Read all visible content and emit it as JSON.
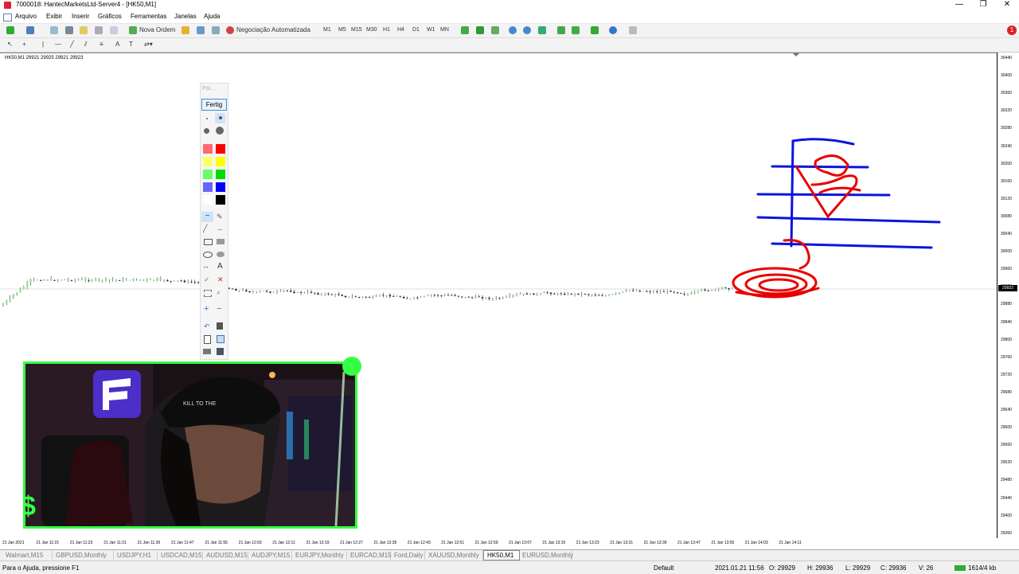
{
  "window": {
    "title": "7000018: HantecMarketsLtd-Server4 - [HK50,M1]",
    "controls": [
      "—",
      "❐",
      "✕"
    ]
  },
  "menu": [
    "Arquivo",
    "Exibir",
    "Inserir",
    "Gráficos",
    "Ferramentas",
    "Janelas",
    "Ajuda"
  ],
  "toolbar": {
    "new_order": "Nova Ordem",
    "auto_trading": "Negociação Automatizada",
    "timeframes": [
      "M1",
      "M5",
      "M15",
      "M30",
      "H1",
      "H4",
      "D1",
      "W1",
      "MN"
    ],
    "notification_count": "1"
  },
  "chart": {
    "info": "HK50,M1  29921 29925 29921 29923",
    "current_price": "29923",
    "price_ticks": [
      "30440",
      "30400",
      "30360",
      "30320",
      "30280",
      "30240",
      "30200",
      "30160",
      "30120",
      "30080",
      "30040",
      "30000",
      "29960",
      "29920",
      "29880",
      "29840",
      "29800",
      "29760",
      "29720",
      "29680",
      "29640",
      "29600",
      "29560",
      "29520",
      "29480",
      "29440",
      "29400",
      "29360"
    ],
    "time_ticks": [
      "21 Jan 2021",
      "21 Jan 11:15",
      "21 Jan 11:23",
      "21 Jan 11:31",
      "21 Jan 11:39",
      "21 Jan 11:47",
      "21 Jan 11:55",
      "21 Jan 12:03",
      "21 Jan 12:11",
      "21 Jan 12:19",
      "21 Jan 12:27",
      "21 Jan 12:35",
      "21 Jan 12:43",
      "21 Jan 12:51",
      "21 Jan 12:59",
      "21 Jan 13:07",
      "21 Jan 13:15",
      "21 Jan 13:23",
      "21 Jan 13:31",
      "21 Jan 13:39",
      "21 Jan 13:47",
      "21 Jan 13:55",
      "21 Jan 14:03",
      "21 Jan 14:11"
    ]
  },
  "palette": {
    "title": "Poi...",
    "done_label": "Fertig",
    "colors": [
      "#ff6b6b",
      "#ff0000",
      "#ffff66",
      "#ffff00",
      "#66ff66",
      "#00dd00",
      "#6666ff",
      "#0000ff",
      "#ffffff",
      "#000000"
    ],
    "text_tool": "A"
  },
  "tabs": [
    "Walmart,M15",
    "GBPUSD,Monthly",
    "USDJPY,H1",
    "USDCAD,M15",
    "AUDUSD,M15",
    "AUDJPY,M15",
    "EURJPY,Monthly",
    "EURCAD,M15",
    "Ford,Daily",
    "XAUUSD,Monthly",
    "HK50,M1",
    "EURUSD,Monthly"
  ],
  "active_tab": "HK50,M1",
  "status": {
    "help": "Para o Ajuda, pressione F1",
    "profile": "Default",
    "datetime": "2021.01.21 11:56",
    "open": "O: 29929",
    "high": "H: 29936",
    "low": "L: 29929",
    "close": "C: 29936",
    "volume": "V: 26",
    "traffic": "1614/4 kb"
  },
  "webcam": {
    "cap_text": "KILL TO THE"
  },
  "colors": {
    "annotation_red": "#e80000",
    "annotation_blue": "#0a14e0",
    "webcam_frame": "#34ff43"
  }
}
